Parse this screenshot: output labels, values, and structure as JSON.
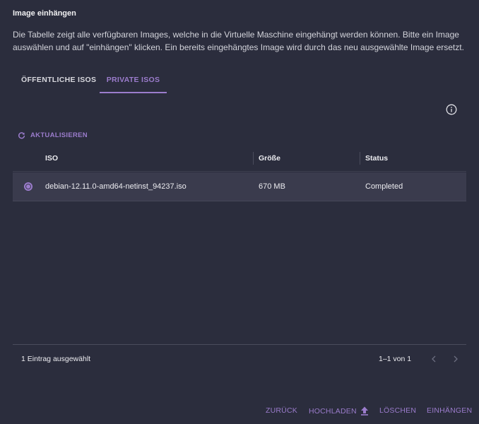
{
  "dialog": {
    "title": "Image einhängen",
    "description": "Die Tabelle zeigt alle verfügbaren Images, welche in die Virtuelle Maschine eingehängt werden können. Bitte ein Image auswählen und auf \"einhängen\" klicken. Ein bereits eingehängtes Image wird durch das neu ausgewählte Image ersetzt."
  },
  "tabs": [
    {
      "label": "ÖFFENTLICHE ISOS",
      "active": false
    },
    {
      "label": "PRIVATE ISOS",
      "active": true
    }
  ],
  "toolbar": {
    "refresh_label": "AKTUALISIEREN",
    "refresh_icon": "refresh-icon",
    "info_icon": "info-icon"
  },
  "table": {
    "columns": [
      "ISO",
      "Größe",
      "Status"
    ],
    "rows": [
      {
        "selected": true,
        "iso": "debian-12.11.0-amd64-netinst_94237.iso",
        "size": "670 MB",
        "status": "Completed"
      }
    ]
  },
  "footer": {
    "selected_text": "1 Eintrag ausgewählt",
    "page_range": "1–1 von 1"
  },
  "actions": {
    "back": "ZURÜCK",
    "upload": "HOCHLADEN",
    "upload_icon": "upload-icon",
    "delete": "LÖSCHEN",
    "mount": "EINHÄNGEN"
  },
  "colors": {
    "background": "#2b2d3d",
    "accent": "#9b7ccc",
    "selected_row": "#3a3b4d"
  }
}
